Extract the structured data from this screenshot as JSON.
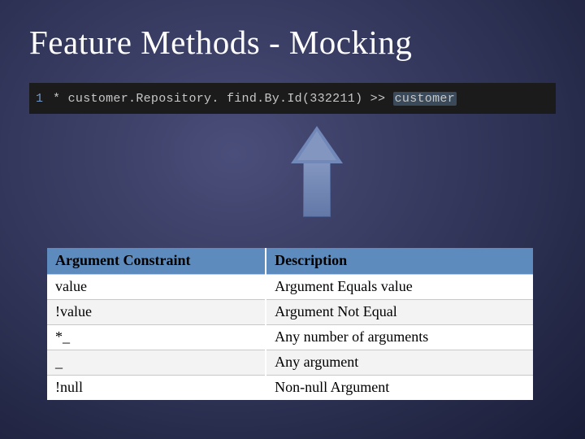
{
  "title": "Feature Methods - Mocking",
  "code": {
    "line_number": "1",
    "text_prefix": "* customer.Repository. find.By.Id(332211) >> ",
    "highlighted": "customer"
  },
  "table": {
    "headers": {
      "constraint": "Argument Constraint",
      "description": "Description"
    },
    "rows": [
      {
        "constraint": "value",
        "description": "Argument Equals value"
      },
      {
        "constraint": "!value",
        "description": "Argument Not Equal"
      },
      {
        "constraint": "*_",
        "description": "Any number of arguments"
      },
      {
        "constraint": "_",
        "description": "Any argument"
      },
      {
        "constraint": "!null",
        "description": "Non-null Argument"
      }
    ]
  }
}
